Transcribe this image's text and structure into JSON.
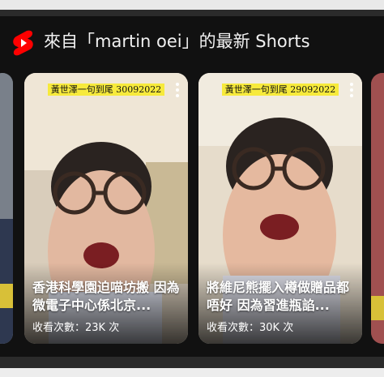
{
  "shelf": {
    "title": "來自「martin oei」的最新 Shorts"
  },
  "cards": [
    {
      "caption": "黃世澤一句到尾 30092022",
      "title": "香港科學園迫喵坊搬 因為微電子中心係北京...",
      "views": "收看次數：23K 次"
    },
    {
      "caption": "黃世澤一句到尾 29092022",
      "title": "將維尼熊擺入樽做贈品都唔好 因為習進瓶諂...",
      "views": "收看次數：30K 次"
    }
  ],
  "colors": {
    "brand_red": "#ff0000",
    "caption_yellow": "#f7ea3c",
    "background": "#111111"
  }
}
